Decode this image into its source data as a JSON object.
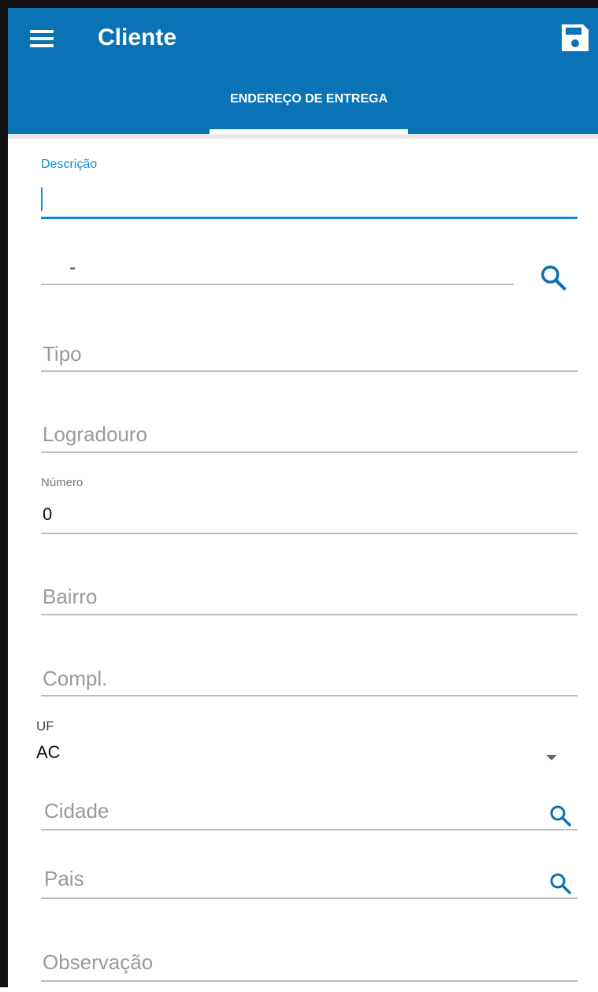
{
  "appbar": {
    "title": "Cliente",
    "menu_icon": "menu-icon",
    "save_icon": "save-icon",
    "color": "#0a73b5"
  },
  "tabs": [
    {
      "label": "ENDEREÇO DE ENTREGA",
      "active": true
    }
  ],
  "form": {
    "descricao": {
      "label": "Descrição",
      "value": ""
    },
    "cep": {
      "value": "-",
      "action_icon": "search-icon"
    },
    "tipo": {
      "placeholder": "Tipo"
    },
    "logradouro": {
      "placeholder": "Logradouro"
    },
    "numero": {
      "label": "Número",
      "value": "0"
    },
    "bairro": {
      "placeholder": "Bairro"
    },
    "compl": {
      "placeholder": "Compl."
    },
    "uf": {
      "label": "UF",
      "value": "AC"
    },
    "cidade": {
      "placeholder": "Cidade",
      "action_icon": "search-icon"
    },
    "pais": {
      "placeholder": "Pais",
      "action_icon": "search-icon"
    },
    "observacao": {
      "placeholder": "Observação"
    }
  },
  "accent_color": "#0a8fd6"
}
